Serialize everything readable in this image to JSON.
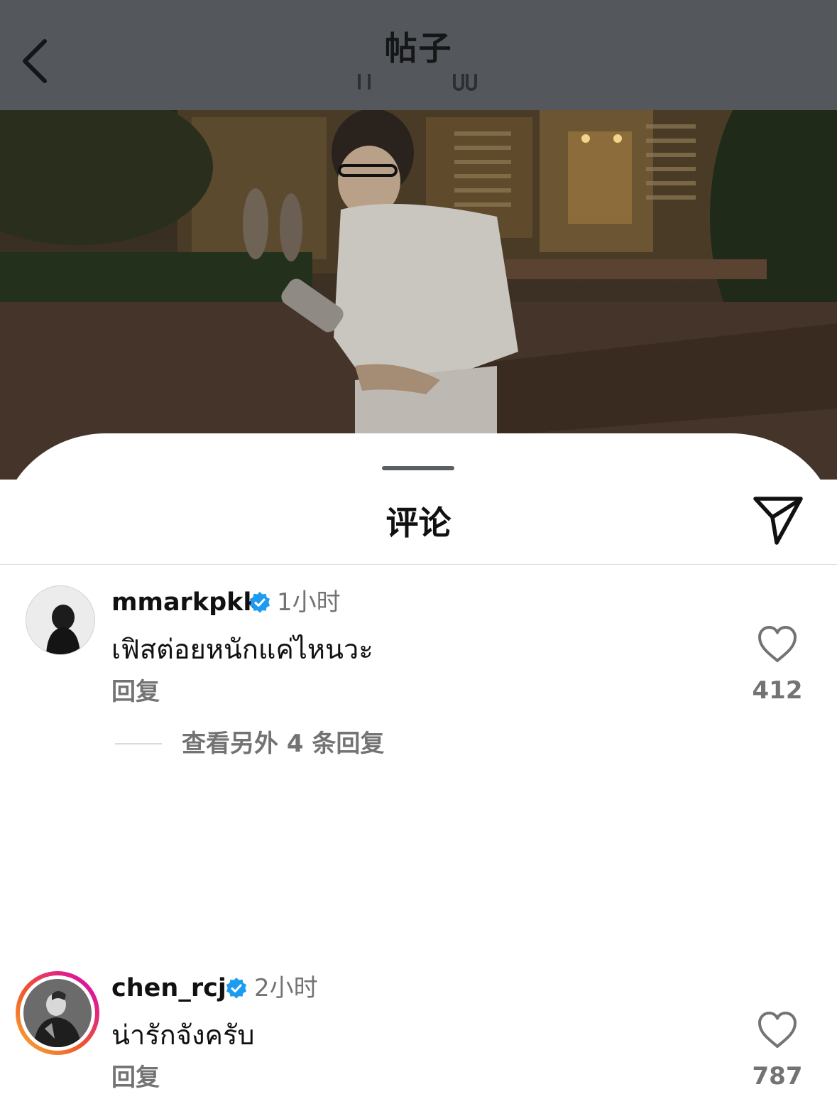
{
  "header": {
    "title": "帖子",
    "back_icon": "chevron-left-icon"
  },
  "post": {
    "photo_description_icon": "post-photo"
  },
  "comments_sheet": {
    "title": "评论",
    "share_icon": "send-icon",
    "comments": [
      {
        "username": "mmarkpkk",
        "verified": true,
        "time": "1小时",
        "text": "เฟิสต่อยหนักแค่ไหนวะ",
        "reply_label": "回复",
        "likes": "412",
        "view_replies_label": "查看另外 4 条回复"
      },
      {
        "username": "chen_rcj",
        "verified": true,
        "time": "2小时",
        "text": "น่ารักจังครับ",
        "reply_label": "回复",
        "likes": "787"
      }
    ]
  },
  "colors": {
    "topbar": "#54585c",
    "verified_blue": "#1d9bf0",
    "secondary_text": "#737373",
    "story_ring_start": "#f9b233",
    "story_ring_end": "#d300c5"
  }
}
